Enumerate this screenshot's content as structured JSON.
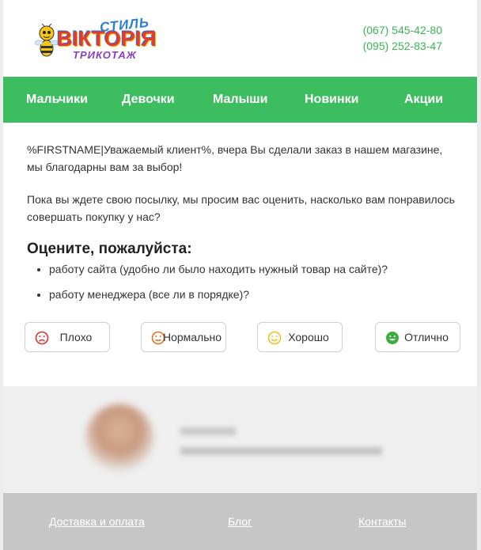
{
  "header": {
    "logo": {
      "top": "СТИЛЬ",
      "main": "ВІКТОРІЯ",
      "bottom": "ТРИКОТАЖ"
    },
    "phones": [
      "(067) 545-42-80",
      "(095) 252-83-47"
    ]
  },
  "nav": {
    "items": [
      "Мальчики",
      "Девочки",
      "Малыши",
      "Новинки",
      "Акции"
    ]
  },
  "content": {
    "para1": "%FIRSTNAME|Уважаемый клиент%, вчера Вы сделали заказ в нашем магазине, мы благодарны вам за выбор!",
    "para2": "Пока вы ждете свою посылку, мы просим вас оценить, насколько вам понравилось совершать покупку у нас?",
    "heading": "Оцените, пожалуйста:",
    "criteria": [
      "работу сайта (удобно ли было находить нужный товар на сайте)?",
      "работу менеджера (все ли в порядке)?"
    ]
  },
  "rating": {
    "buttons": [
      {
        "label": "Плохо",
        "icon": "sad-face-icon",
        "color": "#e0302a"
      },
      {
        "label": "Нормально",
        "icon": "neutral-face-icon",
        "color": "#e0701f"
      },
      {
        "label": "Хорошо",
        "icon": "smile-face-icon",
        "color": "#f0c020"
      },
      {
        "label": "Отлично",
        "icon": "happy-face-icon",
        "color": "#3cae3c"
      }
    ]
  },
  "footer": {
    "links": [
      "Доставка и оплата",
      "Блог",
      "Контакты"
    ]
  },
  "colors": {
    "accent_green": "#3cbd5f",
    "phone_green": "#3ab556",
    "footer_gray": "#c6c6c6"
  }
}
